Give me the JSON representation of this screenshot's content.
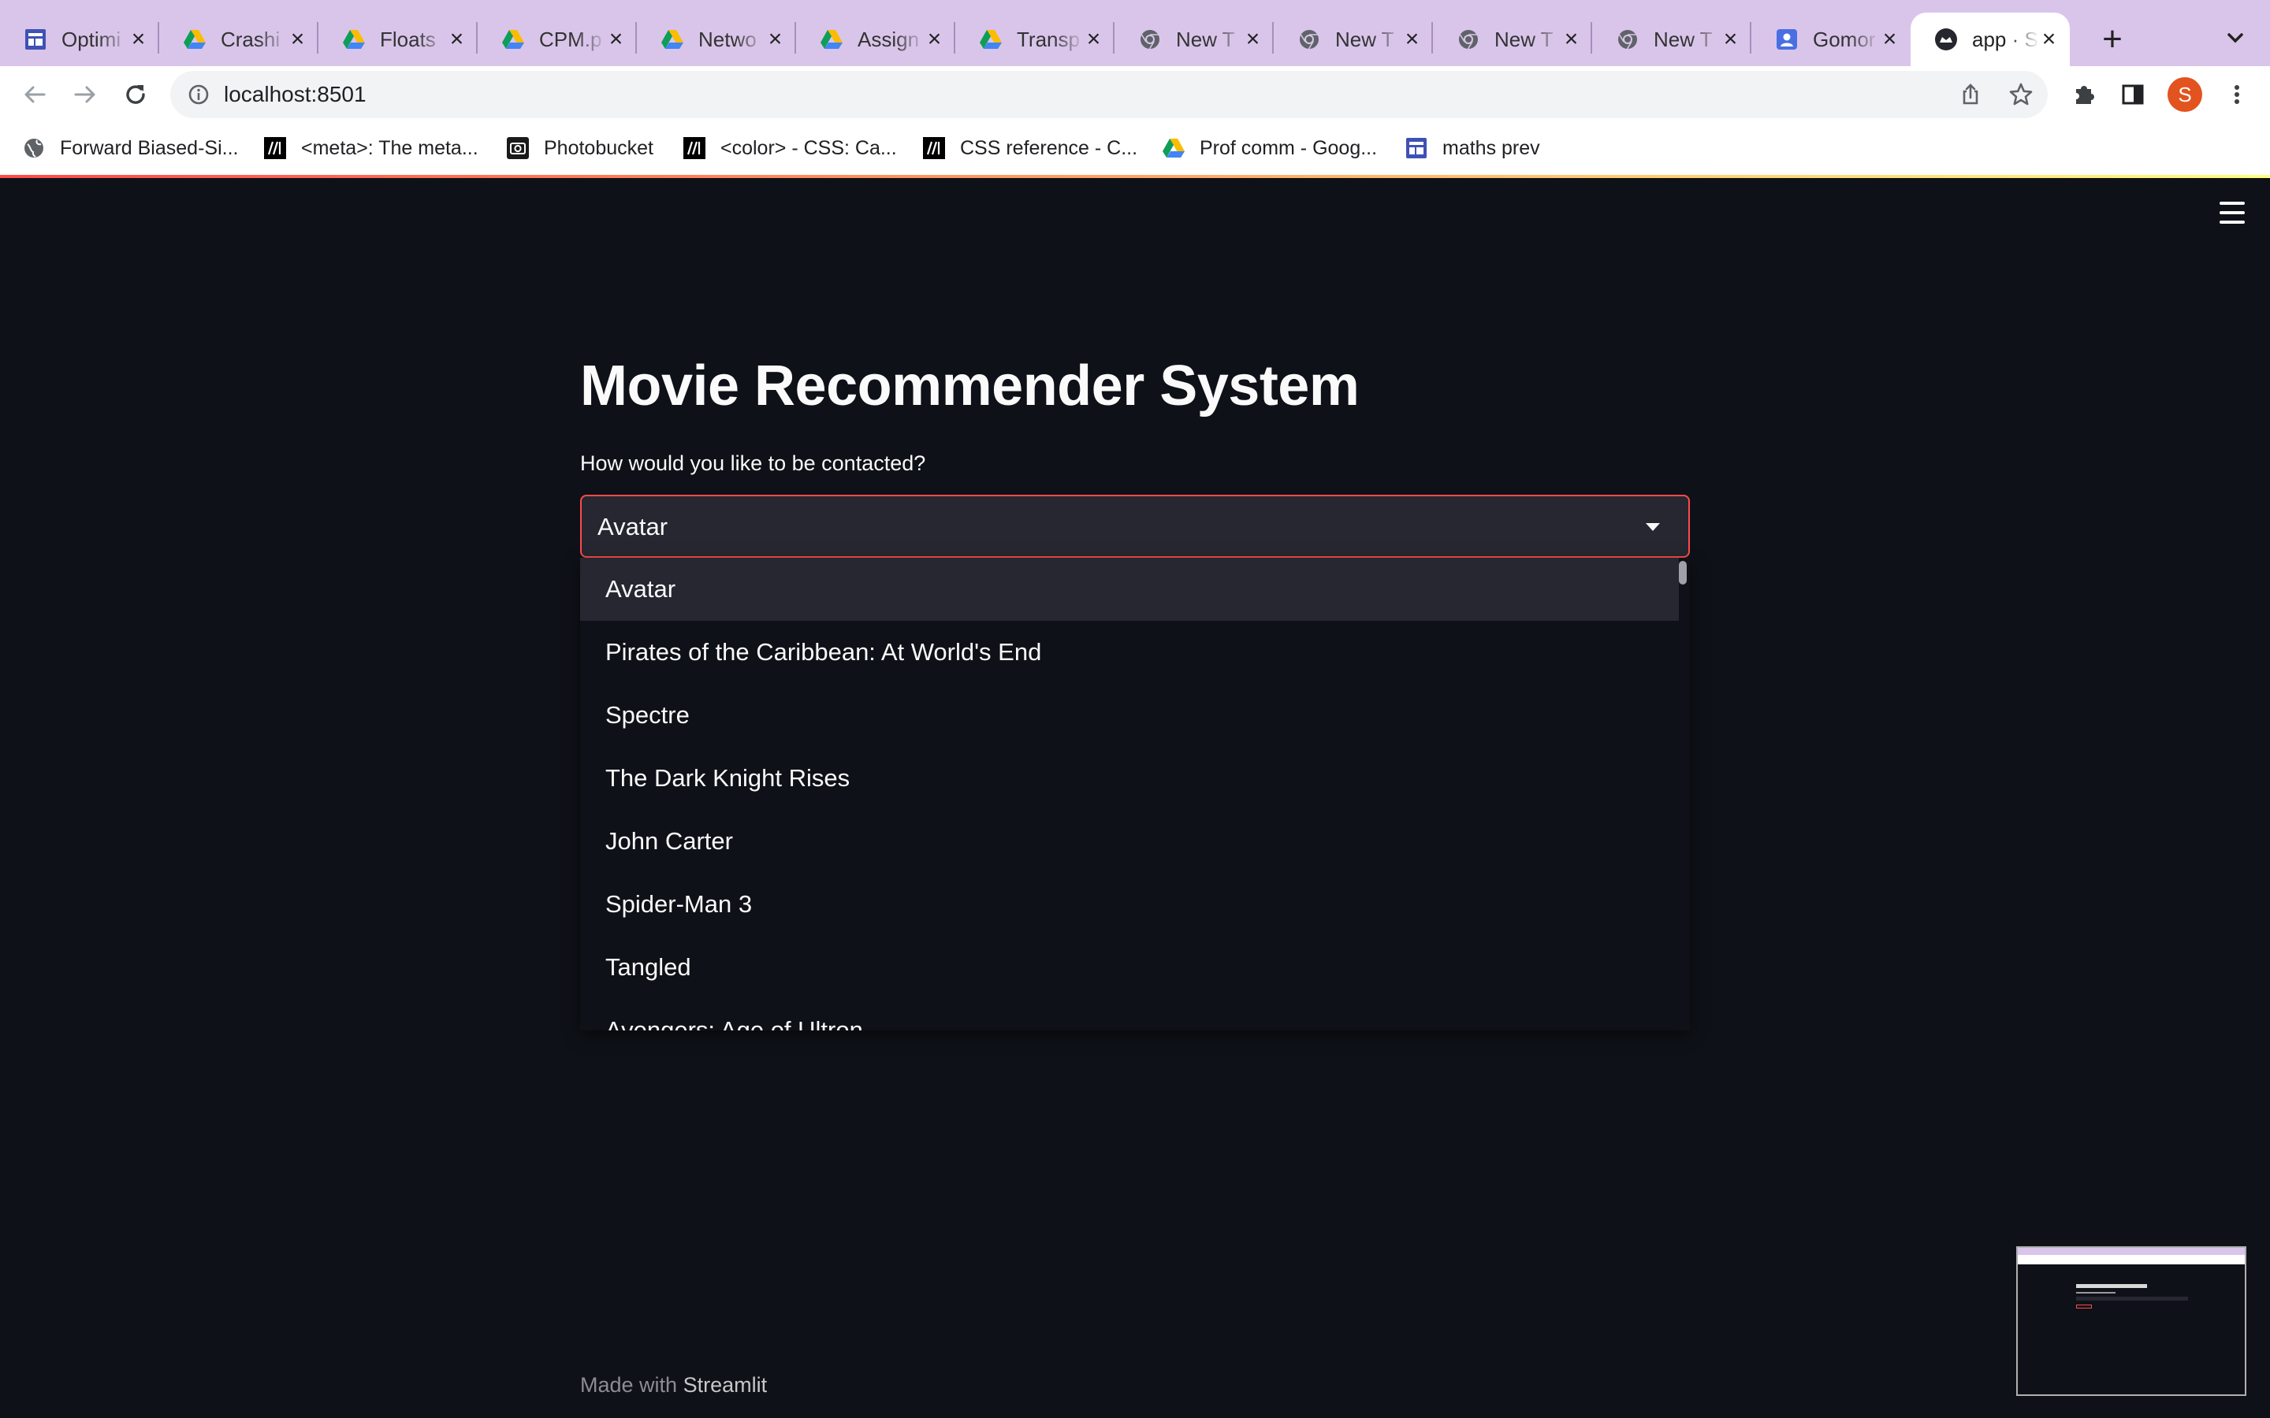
{
  "browser": {
    "tabs": [
      {
        "title": "Optimi",
        "icon": "docs-icon",
        "active": false
      },
      {
        "title": "Crashi",
        "icon": "drive-icon",
        "active": false
      },
      {
        "title": "Floats",
        "icon": "drive-icon",
        "active": false
      },
      {
        "title": "CPM.p",
        "icon": "drive-icon",
        "active": false
      },
      {
        "title": "Netwo",
        "icon": "drive-icon",
        "active": false
      },
      {
        "title": "Assign",
        "icon": "drive-icon",
        "active": false
      },
      {
        "title": "Transp",
        "icon": "drive-icon",
        "active": false
      },
      {
        "title": "New T",
        "icon": "chrome-icon",
        "active": false
      },
      {
        "title": "New T",
        "icon": "chrome-icon",
        "active": false
      },
      {
        "title": "New T",
        "icon": "chrome-icon",
        "active": false
      },
      {
        "title": "New T",
        "icon": "chrome-icon",
        "active": false
      },
      {
        "title": "Gomor",
        "icon": "contact-icon",
        "active": false
      },
      {
        "title": "app · S",
        "icon": "streamlit-icon",
        "active": true
      }
    ],
    "url": "localhost:8501",
    "profile_initial": "S",
    "bookmarks": [
      {
        "label": "Forward Biased-Si...",
        "icon": "globe-icon"
      },
      {
        "label": "<meta>: The meta...",
        "icon": "mdn-icon"
      },
      {
        "label": "Photobucket",
        "icon": "camera-icon"
      },
      {
        "label": "<color> - CSS: Ca...",
        "icon": "mdn-icon"
      },
      {
        "label": "CSS reference - C...",
        "icon": "mdn-icon"
      },
      {
        "label": "Prof comm - Goog...",
        "icon": "drive-icon"
      },
      {
        "label": "maths prev",
        "icon": "docs-icon"
      }
    ]
  },
  "app": {
    "title": "Movie Recommender System",
    "select_label": "How would you like to be contacted?",
    "selected_value": "Avatar",
    "options": [
      "Avatar",
      "Pirates of the Caribbean: At World's End",
      "Spectre",
      "The Dark Knight Rises",
      "John Carter",
      "Spider-Man 3",
      "Tangled",
      "Avengers: Age of Ultron"
    ],
    "footer_prefix": "Made with",
    "footer_brand": "Streamlit"
  },
  "colors": {
    "primary": "#ff4b4b",
    "background": "#0e1117",
    "widget_bg": "#262730",
    "tabbar": "#d9c5ea"
  }
}
